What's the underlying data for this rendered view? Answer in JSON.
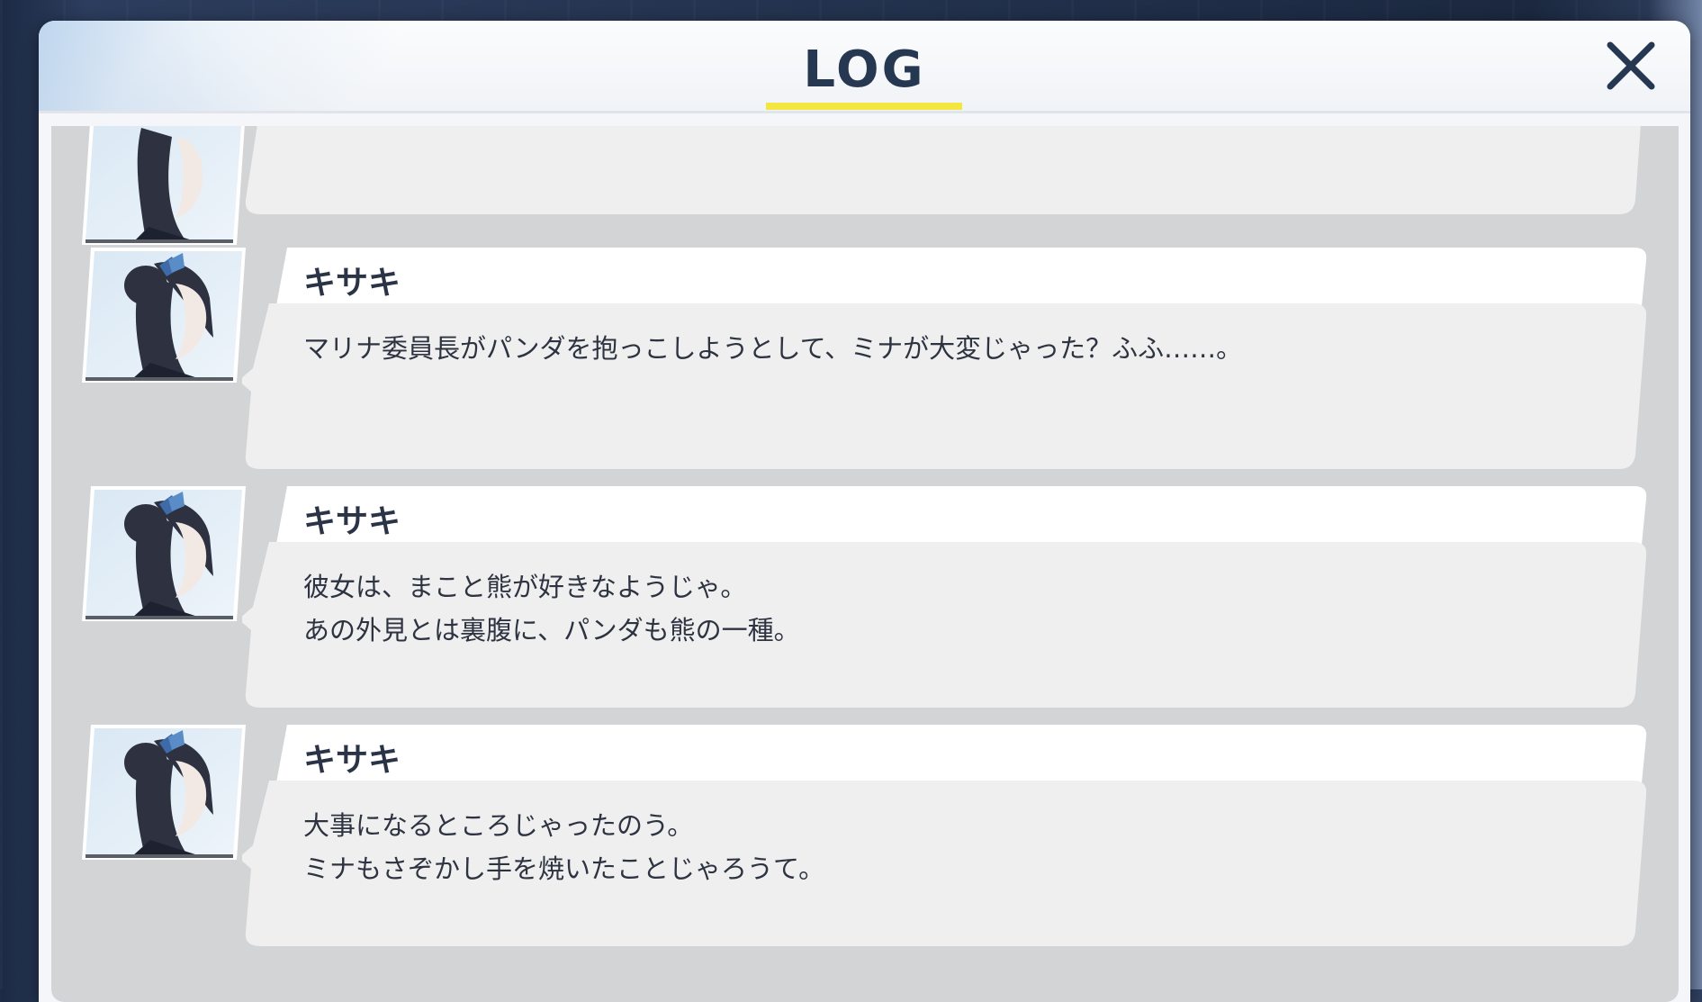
{
  "header": {
    "title": "LOG",
    "close_icon": "close-icon"
  },
  "colors": {
    "title": "#263752",
    "underline": "#f3e640",
    "bubble": "#efefef",
    "log_background": "#d3d4d6"
  },
  "entries": [
    {
      "speaker": "",
      "text": "……？"
    },
    {
      "speaker": "キサキ",
      "text": "マリナ委員長がパンダを抱っこしようとして、ミナが大変じゃった？ふふ……。"
    },
    {
      "speaker": "キサキ",
      "text": "彼女は、まこと熊が好きなようじゃ。\nあの外見とは裏腹に、パンダも熊の一種。"
    },
    {
      "speaker": "キサキ",
      "text": "大事になるところじゃったのう。\nミナもさぞかし手を焼いたことじゃろうて。"
    }
  ]
}
